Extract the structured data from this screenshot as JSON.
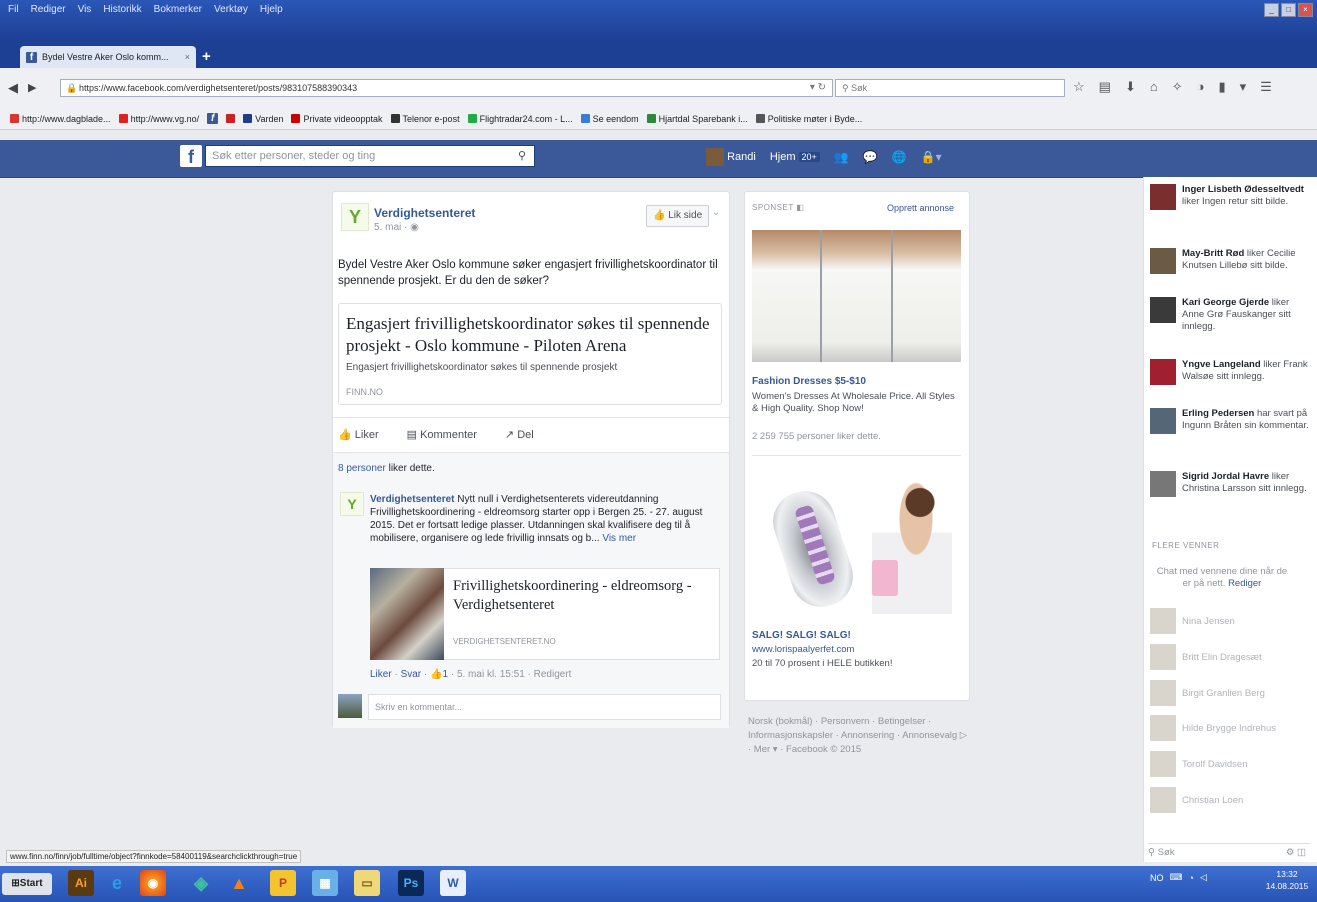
{
  "browser": {
    "menu": [
      "Fil",
      "Rediger",
      "Vis",
      "Historikk",
      "Bokmerker",
      "Verktøy",
      "Hjelp"
    ],
    "tab_title": "Bydel Vestre Aker Oslo komm...",
    "url": "https://www.facebook.com/verdighetsenteret/posts/983107588390343",
    "search_placeholder": "Søk",
    "bookmarks": [
      "http://www.dagblade...",
      "http://www.vg.no/",
      "Varden",
      "Private videoopptak",
      "Telenor e-post",
      "Flightradar24.com - L...",
      "Se eendom",
      "Hjartdal Sparebank i...",
      "Politiske møter i Byde..."
    ],
    "status_url": "www.finn.no/finn/job/fulltime/object?finnkode=58400119&searchclickthrough=true"
  },
  "fb": {
    "search_placeholder": "Søk etter personer, steder og ting",
    "user": "Randi",
    "home": "Hjem",
    "home_count": "20+"
  },
  "post": {
    "page_name": "Verdighetsenteret",
    "date": "5. mai · ",
    "like_page": "Lik side",
    "text": "Bydel Vestre Aker Oslo kommune søker engasjert frivillighetskoordinator til spennende prosjekt. Er du den de søker?",
    "link_title": "Engasjert frivillighetskoordinator søkes til spennende prosjekt - Oslo kommune - Piloten Arena",
    "link_desc": "Engasjert frivillighetskoordinator søkes til spennende prosjekt",
    "link_source": "FINN.NO",
    "actions": {
      "like": "Liker",
      "comment": "Kommenter",
      "share": "Del"
    },
    "likers_link": "8 personer",
    "likers_rest": " liker dette.",
    "comment": {
      "author": "Verdighetsenteret",
      "text": " Nytt null i Verdighetsenterets videreutdanning Frivillighetskoordinering - eldreomsorg starter opp i Bergen 25. - 27. august 2015. Det er fortsatt ledige plasser. Utdanningen skal kvalifisere deg til å mobilisere, organisere og lede frivillig innsats og b... ",
      "more": "Vis mer",
      "link_title": "Frivillighetskoordinering - eldreomsorg - Verdighetsenteret",
      "link_source": "VERDIGHETSENTERET.NO",
      "like": "Liker",
      "reply": "Svar",
      "likes": "1",
      "time": "5. mai kl. 15:51 · Redigert"
    },
    "write_comment": "Skriv en kommentar..."
  },
  "ads": {
    "header": "SPONSET",
    "create": "Opprett annonse",
    "ad1": {
      "title": "Fashion Dresses $5-$10",
      "desc": "Women's Dresses At Wholesale Price. All Styles & High Quality. Shop Now!",
      "likes": "2 259 755 personer liker dette."
    },
    "ad2": {
      "title": "SALG! SALG! SALG!",
      "url": "www.lorispaalyerfet.com",
      "desc": "20 til 70 prosent i HELE butikken!"
    }
  },
  "footer": "Norsk (bokmål) · Personvern · Betingelser · Informasjonskapsler · Annonsering · Annonsevalg ▷ · Mer ▾ · Facebook © 2015",
  "ticker": [
    {
      "name": "Inger Lisbeth Ødesseltvedt",
      "rest": " liker Ingen retur sitt bilde."
    },
    {
      "name": "May-Britt Rød",
      "rest": " liker Cecilie Knutsen Lillebø sitt bilde."
    },
    {
      "name": "Kari George Gjerde",
      "rest": " liker Anne Grø Fauskanger sitt innlegg."
    },
    {
      "name": "Yngve Langeland",
      "rest": " liker Frank Walsøe sitt innlegg."
    },
    {
      "name": "Erling Pedersen",
      "rest": " har svart på Ingunn Bråten sin kommentar."
    },
    {
      "name": "Sigrid Jordal Havre",
      "rest": " liker Christina Larsson sitt innlegg."
    }
  ],
  "more_friends": {
    "header": "FLERE VENNER",
    "note": "Chat med vennene dine når de er på nett. ",
    "edit": "Rediger",
    "names": [
      "Nina Jensen",
      "Britt Elin Dragesæt",
      "Birgit Granlien Berg",
      "Hilde Brygge Indrehus",
      "Torolf Davidsen",
      "Christian Loen"
    ]
  },
  "chat_search": "Søk",
  "taskbar": {
    "start": "Start",
    "lang": "NO",
    "time": "13:32",
    "date": "14.08.2015"
  }
}
